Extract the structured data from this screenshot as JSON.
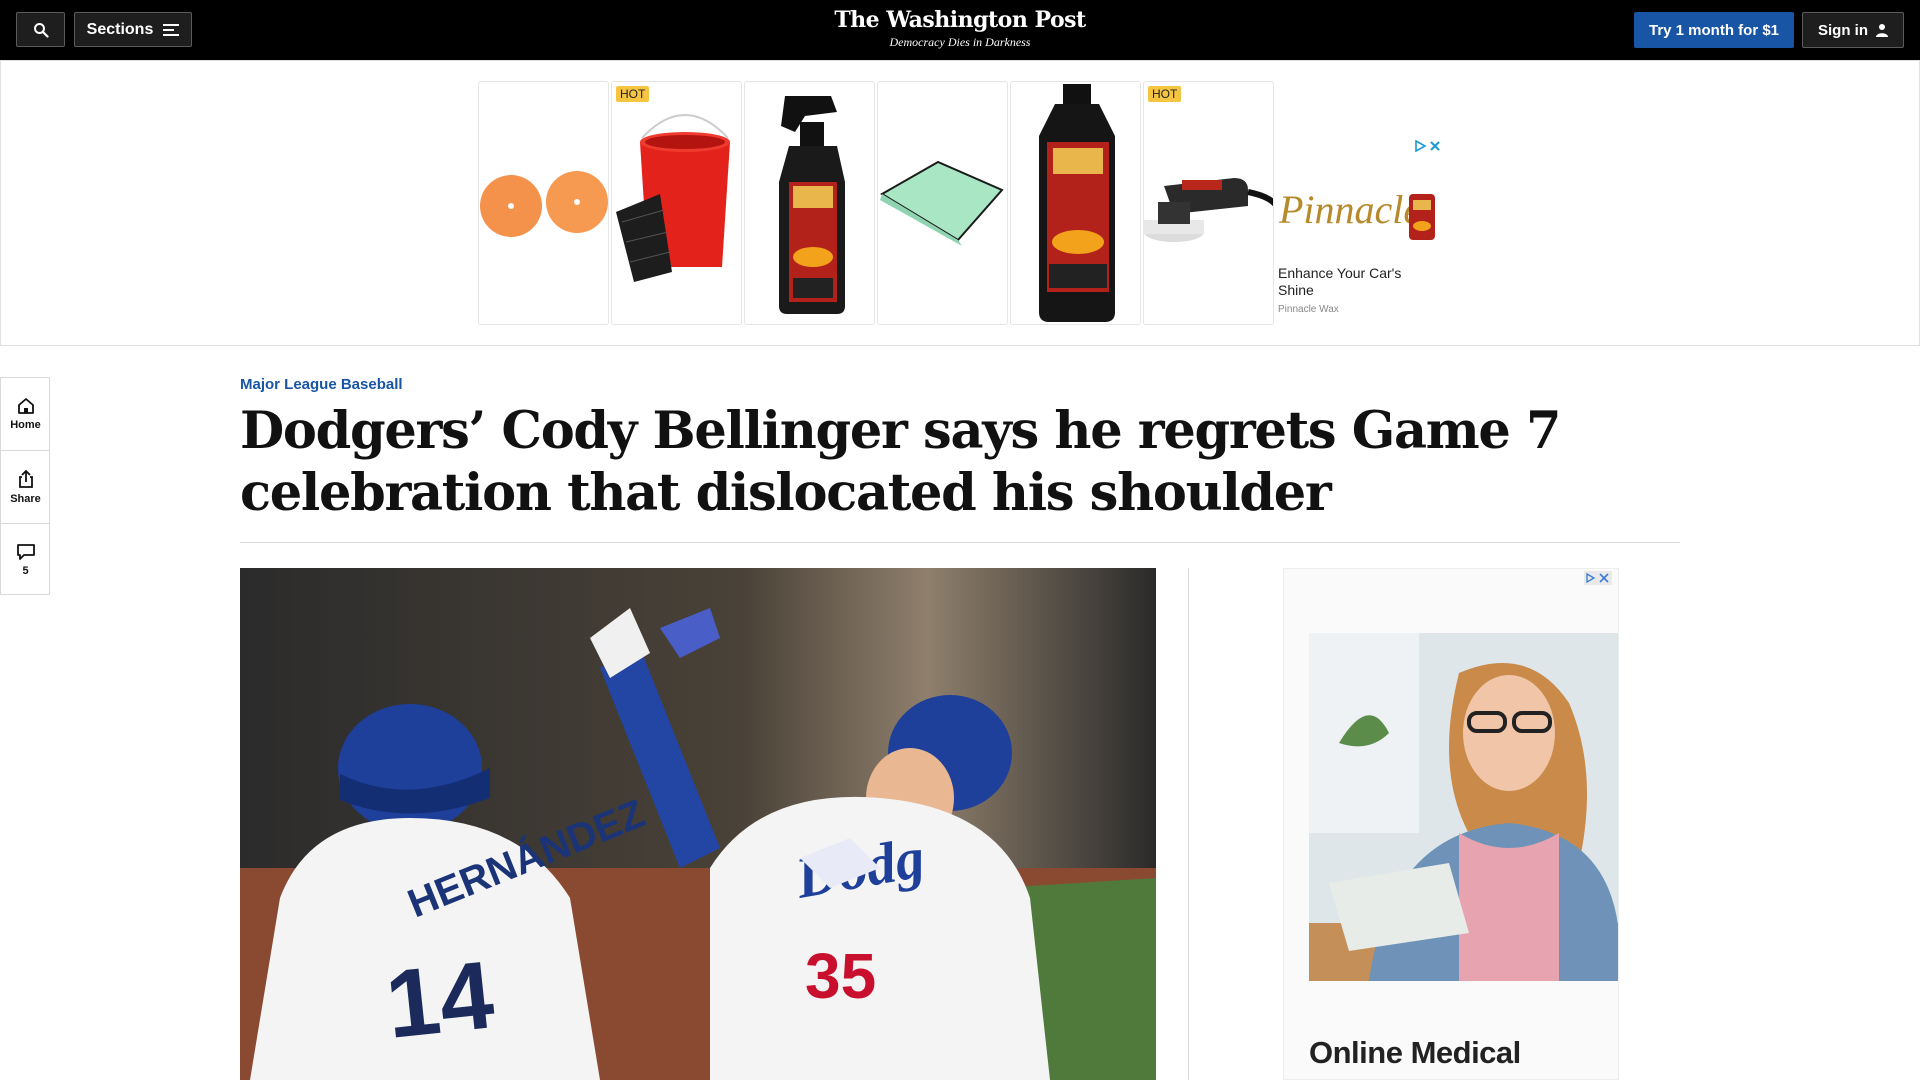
{
  "header": {
    "sections_label": "Sections",
    "logo": "The Washington Post",
    "tagline": "Democracy Dies in Darkness",
    "cta_label": "Try 1 month for $1",
    "signin_label": "Sign in"
  },
  "top_ad": {
    "tiles": [
      {
        "badge": ""
      },
      {
        "badge": "HOT"
      },
      {
        "badge": ""
      },
      {
        "badge": ""
      },
      {
        "badge": ""
      },
      {
        "badge": "HOT"
      }
    ],
    "brand_logo": "Pinnacle",
    "headline": "Enhance Your Car's Shine",
    "advertiser": "Pinnacle Wax"
  },
  "left_rail": {
    "home_label": "Home",
    "share_label": "Share",
    "comments_count": "5"
  },
  "article": {
    "kicker": "Major League Baseball",
    "headline": "Dodgers’ Cody Bellinger says he regrets Game 7 celebration that dislocated his shoulder",
    "jersey_left_name": "HERNÁNDEZ",
    "jersey_left_number": "14",
    "jersey_right_number": "35"
  },
  "side_ad": {
    "title": "Online Medical"
  },
  "colors": {
    "topbar_bg": "#000000",
    "accent_blue": "#1955a5",
    "kicker_blue": "#1955a5",
    "hot_badge": "#f5c542"
  }
}
